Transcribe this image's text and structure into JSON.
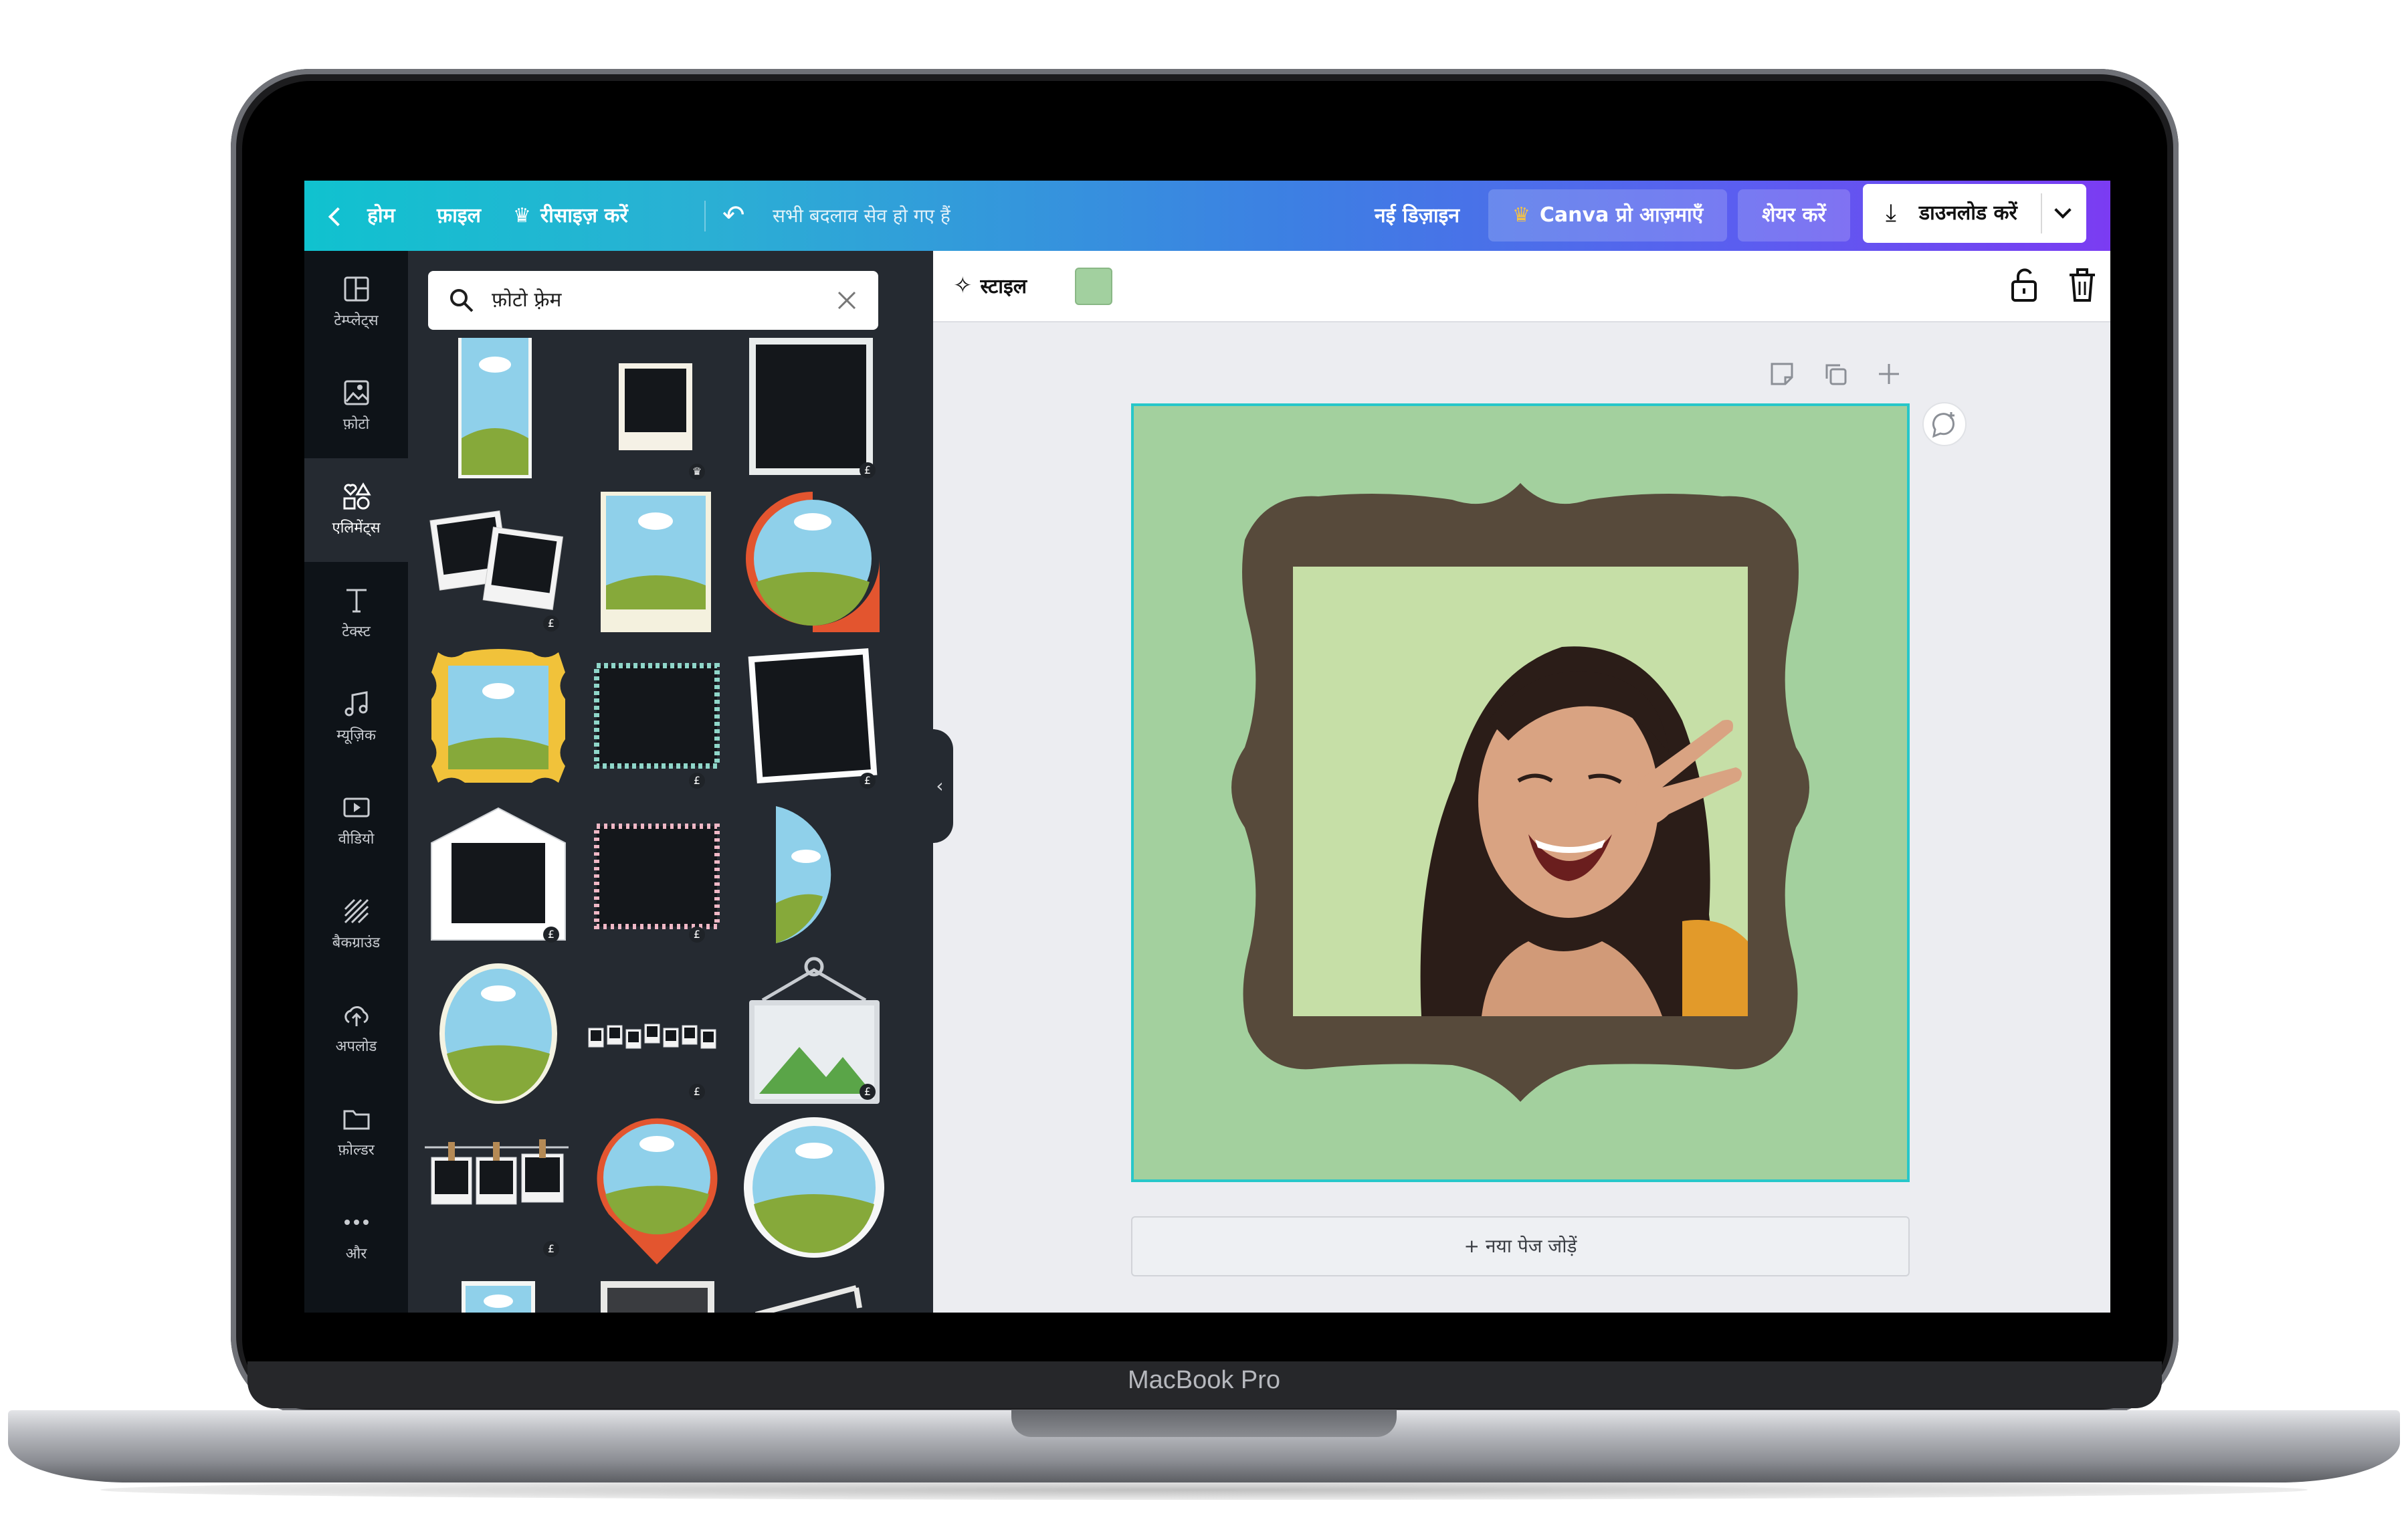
{
  "device": {
    "brand": "MacBook Pro"
  },
  "topbar": {
    "home": "होम",
    "file": "फ़ाइल",
    "resize": "रीसाइज़ करें",
    "saved_status": "सभी बदलाव सेव हो गए हैं",
    "new_design": "नई डिज़ाइन",
    "try_pro": "Canva प्रो आज़माएँ",
    "share": "शेयर करें",
    "download": "डाउनलोड करें"
  },
  "sidebar": {
    "items": [
      {
        "label": "टेम्प्लेट्स",
        "icon": "templates-icon"
      },
      {
        "label": "फ़ोटो",
        "icon": "photos-icon"
      },
      {
        "label": "एलिमेंट्स",
        "icon": "elements-icon"
      },
      {
        "label": "टेक्स्ट",
        "icon": "text-icon"
      },
      {
        "label": "म्यूज़िक",
        "icon": "music-icon"
      },
      {
        "label": "वीडियो",
        "icon": "video-icon"
      },
      {
        "label": "बैकग्राउंड",
        "icon": "background-icon"
      },
      {
        "label": "अपलोड",
        "icon": "upload-icon"
      },
      {
        "label": "फ़ोल्डर",
        "icon": "folder-icon"
      },
      {
        "label": "और",
        "icon": "more-icon"
      }
    ],
    "active_index": 2
  },
  "panel": {
    "search_value": "फ़ोटो फ़्रेम",
    "badge_pro": "£"
  },
  "canvas": {
    "style_label": "स्टाइल",
    "swatch_color": "#a2d09f",
    "page_background": "#a3d09e",
    "frame_color": "#574a3b",
    "add_page": "+ नया पेज जोड़ें"
  },
  "colors": {
    "accent_teal": "#10c2cf",
    "accent_purple": "#7b3cf2",
    "selection": "#27c7c9"
  }
}
